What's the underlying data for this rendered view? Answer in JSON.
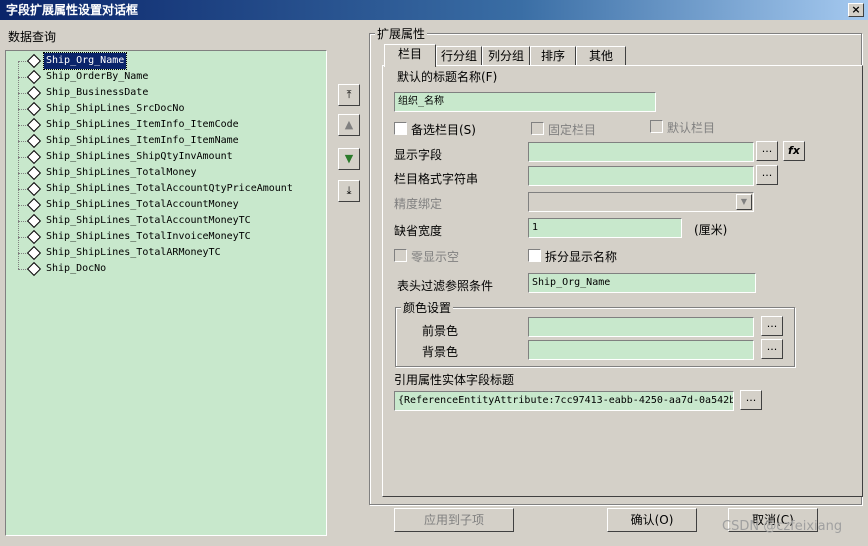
{
  "window": {
    "title": "字段扩展属性设置对话框",
    "close_glyph": "×"
  },
  "left": {
    "heading": "数据查询",
    "tree_items": [
      "Ship_Org_Name",
      "Ship_OrderBy_Name",
      "Ship_BusinessDate",
      "Ship_ShipLines_SrcDocNo",
      "Ship_ShipLines_ItemInfo_ItemCode",
      "Ship_ShipLines_ItemInfo_ItemName",
      "Ship_ShipLines_ShipQtyInvAmount",
      "Ship_ShipLines_TotalMoney",
      "Ship_ShipLines_TotalAccountQtyPriceAmount",
      "Ship_ShipLines_TotalAccountMoney",
      "Ship_ShipLines_TotalAccountMoneyTC",
      "Ship_ShipLines_TotalInvoiceMoneyTC",
      "Ship_ShipLines_TotalARMoneyTC",
      "Ship_DocNo"
    ],
    "selected_index": 0
  },
  "side_buttons": {
    "top_glyph": "⤒",
    "up_glyph": "▲",
    "down_glyph": "▼",
    "bottom_glyph": "⤓"
  },
  "right": {
    "group_title": "扩展属性",
    "tabs": [
      "栏目",
      "行分组",
      "列分组",
      "排序",
      "其他"
    ],
    "active_tab": 0,
    "form": {
      "default_title_label": "默认的标题名称(F)",
      "default_title_value": "组织_名称",
      "optional_col_label": "备选栏目(S)",
      "fixed_col_label": "固定栏目",
      "default_col_label": "默认栏目",
      "display_field_label": "显示字段",
      "format_string_label": "栏目格式字符串",
      "precision_label": "精度绑定",
      "default_width_label": "缺省宽度",
      "default_width_value": "1",
      "width_unit": "(厘米)",
      "zero_empty_label": "零显示空",
      "split_name_label": "拆分显示名称",
      "header_filter_label": "表头过滤参照条件",
      "header_filter_value": "Ship_Org_Name",
      "color_group_title": "颜色设置",
      "foreground_label": "前景色",
      "background_label": "背景色",
      "ref_entity_label": "引用属性实体字段标题",
      "ref_entity_value": "{ReferenceEntityAttribute:7cc97413-eabb-4250-aa7d-0a542b",
      "ellipsis": "...",
      "fx": "fx",
      "dropdown_glyph": "▼"
    }
  },
  "footer": {
    "apply_label": "应用到子项",
    "ok_label": "确认(O)",
    "cancel_label": "取消(C)"
  },
  "watermark": "CSDN @czfeixiang"
}
